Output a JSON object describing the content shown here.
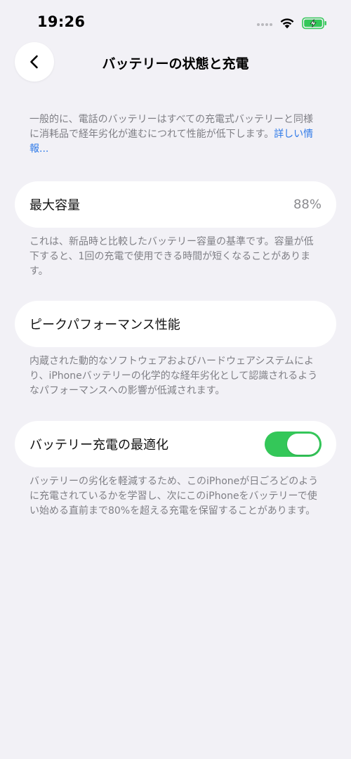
{
  "status_bar": {
    "time": "19:26",
    "icons": [
      "wifi-icon",
      "battery-charging-icon"
    ]
  },
  "nav": {
    "back_icon": "chevron-left-icon",
    "title": "バッテリーの状態と充電"
  },
  "intro": {
    "text": "一般的に、電話のバッテリーはすべての充電式バッテリーと同様に消耗品で経年劣化が進むにつれて性能が低下します。",
    "link": "詳しい情報..."
  },
  "max_capacity": {
    "label": "最大容量",
    "value": "88%",
    "footnote": "これは、新品時と比較したバッテリー容量の基準です。容量が低下すると、1回の充電で使用できる時間が短くなることがあります。"
  },
  "peak_performance": {
    "label": "ピークパフォーマンス性能",
    "footnote": "内蔵された動的なソフトウェアおよびハードウェアシステムにより、iPhoneバッテリーの化学的な経年劣化として認識されるようなパフォーマンスへの影響が低減されます。"
  },
  "optimized_charging": {
    "label": "バッテリー充電の最適化",
    "enabled": true,
    "footnote": "バッテリーの劣化を軽減するため、このiPhoneが日ごろどのように充電されているかを学習し、次にこのiPhoneをバッテリーで使い始める直前まで80%を超える充電を保留することがあります。"
  },
  "colors": {
    "background": "#f2f1f6",
    "card": "#ffffff",
    "toggle_on": "#34c759",
    "link": "#2f7ae8",
    "secondary_text": "#7f7f85",
    "battery_charging": "#34c759"
  }
}
